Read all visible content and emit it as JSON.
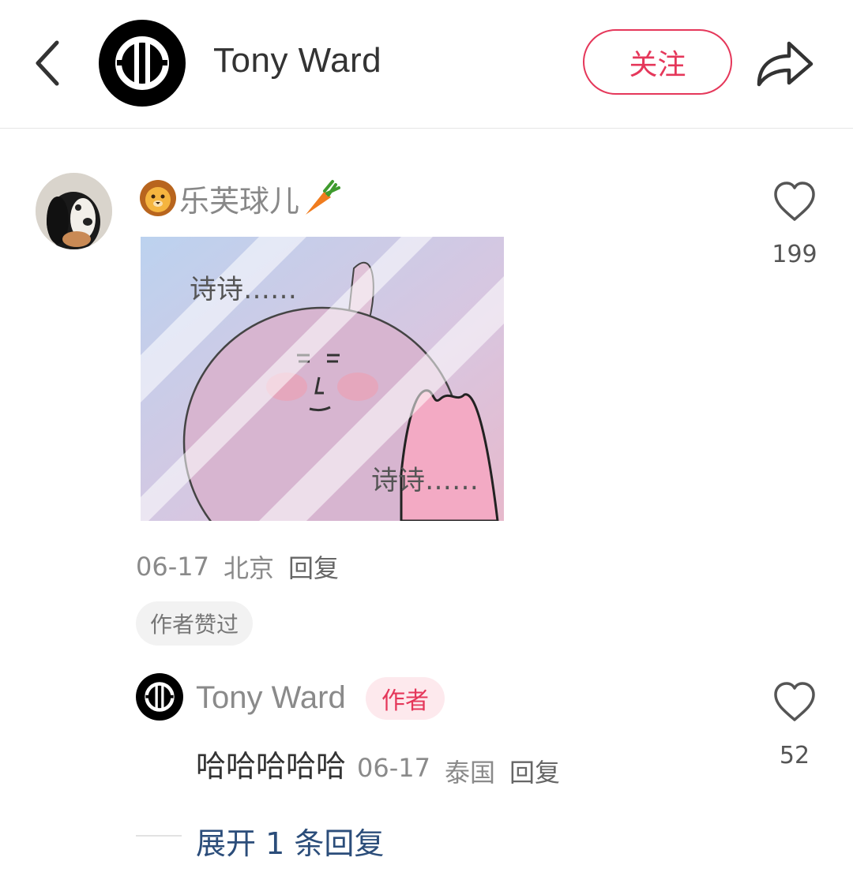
{
  "header": {
    "title": "Tony Ward",
    "follow_label": "关注"
  },
  "comment": {
    "username": "乐芙球儿",
    "name_prefix_icon": "lion-emoji-icon",
    "name_suffix_icon": "carrot-emoji-icon",
    "sticker_caption_top": "诗诗……",
    "sticker_caption_bottom": "诗诗……",
    "date": "06-17",
    "location": "北京",
    "reply_label": "回复",
    "liked_badge": "作者赞过",
    "like_count": "199"
  },
  "reply": {
    "username": "Tony Ward",
    "author_badge": "作者",
    "text": "哈哈哈哈哈",
    "date": "06-17",
    "location": "泰国",
    "reply_label": "回复",
    "like_count": "52"
  },
  "expand_label": "展开 1 条回复",
  "colors": {
    "accent": "#e5375a",
    "link": "#2b4d7a",
    "muted": "#8a8a8a"
  }
}
